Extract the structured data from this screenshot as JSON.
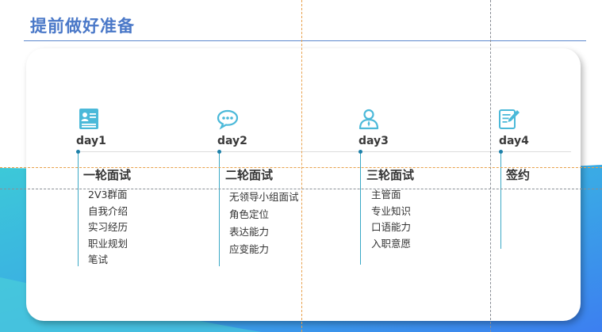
{
  "page": {
    "title": "提前做好准备"
  },
  "colors": {
    "title": "#4a78c8",
    "accent_teal": "#3aa9c6",
    "wave_start": "#3cc9d8",
    "wave_end": "#3c7ff0"
  },
  "days": [
    {
      "label": "day1",
      "icon": "id-card-icon",
      "stage": "一轮面试",
      "tasks": [
        "2V3群面",
        "自我介绍",
        "实习经历",
        "职业规划",
        "笔试"
      ]
    },
    {
      "label": "day2",
      "icon": "chat-bubble-icon",
      "stage": "二轮面试",
      "tasks": [
        "无领导小组面试",
        "角色定位",
        "表达能力",
        "应变能力"
      ]
    },
    {
      "label": "day3",
      "icon": "person-icon",
      "stage": "三轮面试",
      "tasks": [
        "主管面",
        "专业知识",
        "口语能力",
        "入职意愿"
      ]
    },
    {
      "label": "day4",
      "icon": "sign-document-icon",
      "stage": "签约",
      "tasks": []
    }
  ]
}
